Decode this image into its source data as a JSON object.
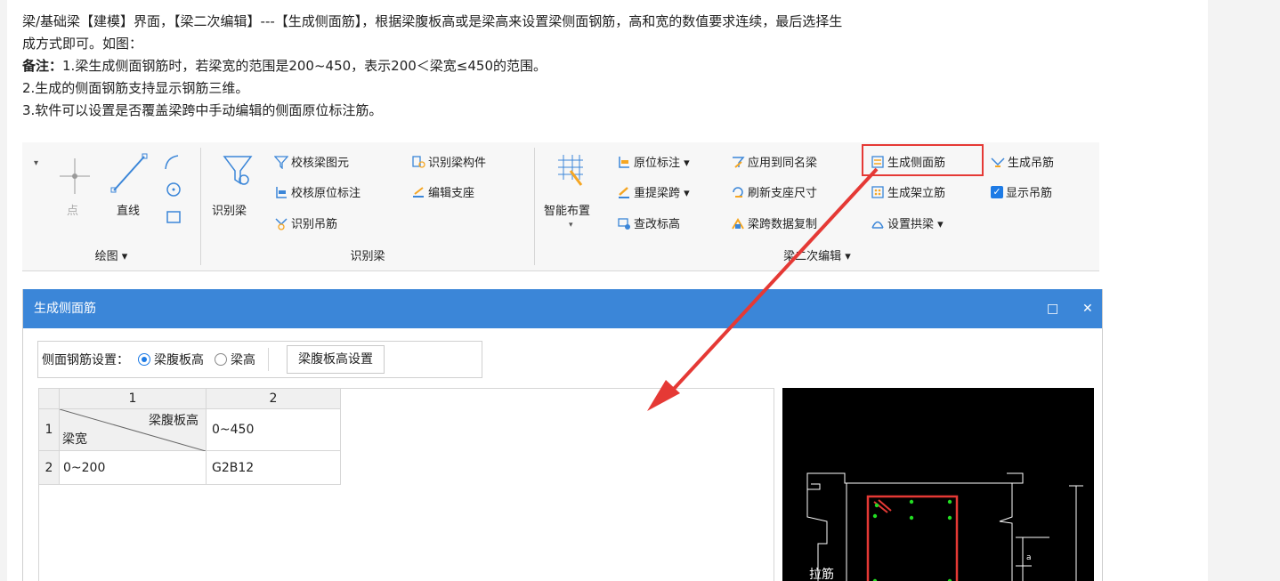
{
  "doc": {
    "line1": "梁/基础梁【建模】界面，【梁二次编辑】---【生成侧面筋】，根据梁腹板高或是梁高来设置梁侧面钢筋，高和宽的数值要求连续，最后选择生",
    "line2": "成方式即可。如图：",
    "note_label": "备注：",
    "line3": "1.梁生成侧面钢筋时，若梁宽的范围是200~450，表示200＜梁宽≤450的范围。",
    "line4": "2.生成的侧面钢筋支持显示钢筋三维。",
    "line5": "3.软件可以设置是否覆盖梁跨中手动编辑的侧面原位标注筋。"
  },
  "ribbon": {
    "draw": {
      "point": "点",
      "line": "直线",
      "title": "绘图 ▾"
    },
    "identify": {
      "big": "识别梁",
      "check_elements": "校核梁图元",
      "check_annotation": "校核原位标注",
      "identify_hanger": "识别吊筋",
      "identify_component": "识别梁构件",
      "edit_support": "编辑支座",
      "title": "识别梁"
    },
    "edit2": {
      "smart_layout": "智能布置",
      "smart_arrow": "▾",
      "in_place": "原位标注 ▾",
      "reextract": "重提梁跨 ▾",
      "change_elev": "查改标高",
      "apply_same": "应用到同名梁",
      "refresh_support": "刷新支座尺寸",
      "span_copy": "梁跨数据复制",
      "gen_side": "生成侧面筋",
      "gen_erect": "生成架立筋",
      "set_arch": "设置拱梁 ▾",
      "gen_hanger": "生成吊筋",
      "show_hanger": "显示吊筋",
      "title": "梁二次编辑 ▾"
    }
  },
  "dialog": {
    "title": "生成侧面筋",
    "maximize": "□",
    "close": "✕",
    "settings_label": "侧面钢筋设置：",
    "opt_web": "梁腹板高",
    "opt_height": "梁高",
    "selected": "梁腹板高",
    "web_btn": "梁腹板高设置",
    "grid": {
      "col_headers": [
        "1",
        "2"
      ],
      "row_headers": [
        "1",
        "2"
      ],
      "diag_top": "梁腹板高",
      "diag_bottom": "梁宽",
      "header_value": "0~450",
      "row2_key": "0~200",
      "row2_value": "G2B12"
    },
    "preview": {
      "label_a": "a",
      "label_tie": "拉筋"
    }
  },
  "colors": {
    "title_bar": "#3b86d8",
    "highlight": "#e53935",
    "rebar": "#e53935",
    "dots": "#22dd22"
  }
}
